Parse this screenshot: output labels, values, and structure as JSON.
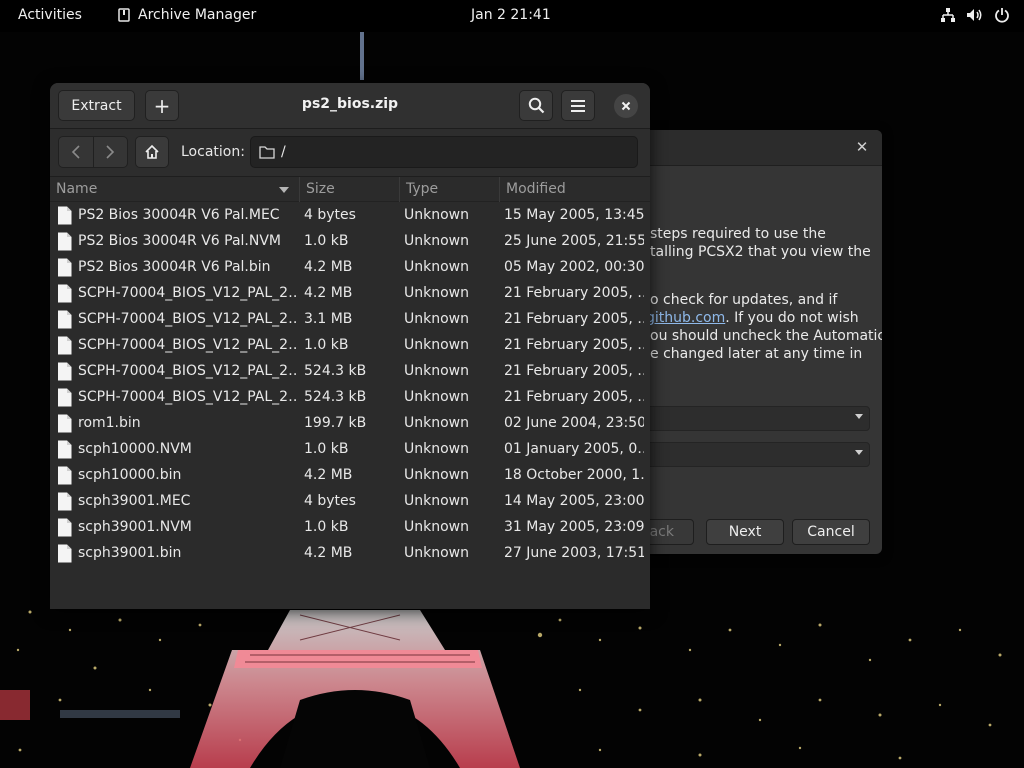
{
  "topbar": {
    "activities": "Activities",
    "app_name": "Archive Manager",
    "clock": "Jan 2  21:41",
    "icons": [
      "network-icon",
      "volume-icon",
      "power-icon"
    ]
  },
  "background_dialog": {
    "text_lines_1": [
      "steps required to use the",
      "talling PCSX2 that you view the"
    ],
    "text_lines_2_prefix": "o check for updates, and if",
    "link": "github.com",
    "link_suffix": ". If you do not wish",
    "text_lines_3": [
      "ou should uncheck the Automatic",
      "e changed later at any time in"
    ],
    "back_label": "Back",
    "next_label": "Next",
    "cancel_label": "Cancel"
  },
  "window": {
    "title": "ps2_bios.zip",
    "extract_label": "Extract",
    "add_label": "+",
    "location_label": "Location:",
    "location_path": "/",
    "columns": {
      "name": "Name",
      "size": "Size",
      "type": "Type",
      "modified": "Modified"
    },
    "files": [
      {
        "name": "PS2 Bios 30004R V6 Pal.MEC",
        "size": "4 bytes",
        "type": "Unknown",
        "modified": "15 May 2005, 13:45"
      },
      {
        "name": "PS2 Bios 30004R V6 Pal.NVM",
        "size": "1.0 kB",
        "type": "Unknown",
        "modified": "25 June 2005, 21:55"
      },
      {
        "name": "PS2 Bios 30004R V6 Pal.bin",
        "size": "4.2 MB",
        "type": "Unknown",
        "modified": "05 May 2002, 00:30"
      },
      {
        "name": "SCPH-70004_BIOS_V12_PAL_2…",
        "size": "4.2 MB",
        "type": "Unknown",
        "modified": "21 February 2005, …"
      },
      {
        "name": "SCPH-70004_BIOS_V12_PAL_2…",
        "size": "3.1 MB",
        "type": "Unknown",
        "modified": "21 February 2005, …"
      },
      {
        "name": "SCPH-70004_BIOS_V12_PAL_2…",
        "size": "1.0 kB",
        "type": "Unknown",
        "modified": "21 February 2005, …"
      },
      {
        "name": "SCPH-70004_BIOS_V12_PAL_2…",
        "size": "524.3 kB",
        "type": "Unknown",
        "modified": "21 February 2005, …"
      },
      {
        "name": "SCPH-70004_BIOS_V12_PAL_2…",
        "size": "524.3 kB",
        "type": "Unknown",
        "modified": "21 February 2005, …"
      },
      {
        "name": "rom1.bin",
        "size": "199.7 kB",
        "type": "Unknown",
        "modified": "02 June 2004, 23:50"
      },
      {
        "name": "scph10000.NVM",
        "size": "1.0 kB",
        "type": "Unknown",
        "modified": "01 January 2005, 0…"
      },
      {
        "name": "scph10000.bin",
        "size": "4.2 MB",
        "type": "Unknown",
        "modified": "18 October 2000, 1…"
      },
      {
        "name": "scph39001.MEC",
        "size": "4 bytes",
        "type": "Unknown",
        "modified": "14 May 2005, 23:00"
      },
      {
        "name": "scph39001.NVM",
        "size": "1.0 kB",
        "type": "Unknown",
        "modified": "31 May 2005, 23:09"
      },
      {
        "name": "scph39001.bin",
        "size": "4.2 MB",
        "type": "Unknown",
        "modified": "27 June 2003, 17:51"
      }
    ]
  }
}
